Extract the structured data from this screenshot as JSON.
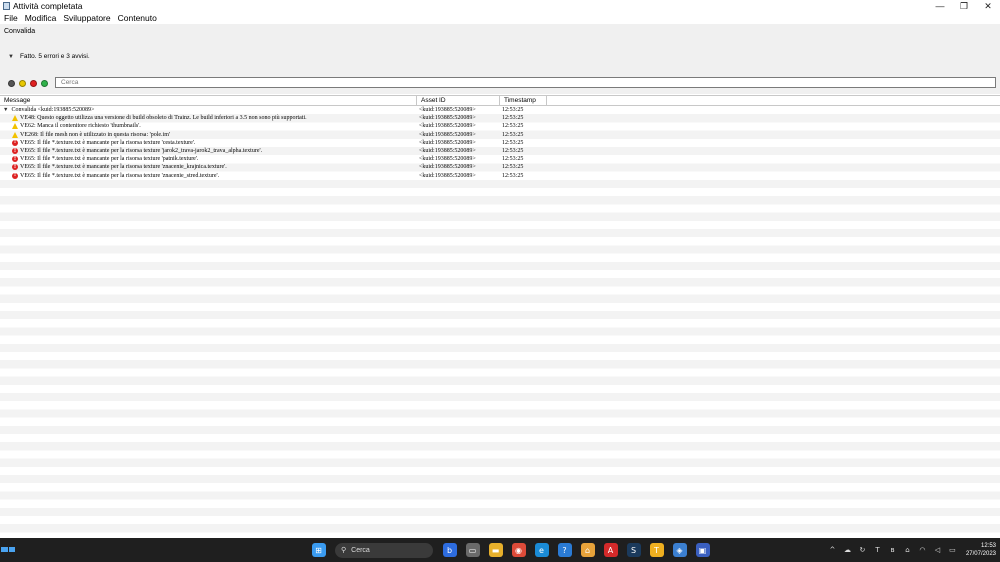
{
  "window": {
    "title": "Attività completata",
    "controls": {
      "minimize": "—",
      "maximize": "❐",
      "close": "✕"
    }
  },
  "menu": [
    "File",
    "Modifica",
    "Sviluppatore",
    "Contenuto"
  ],
  "section_title": "Convalida",
  "status_text": "Fatto. 5 errori e 3 avvisi.",
  "filters": {
    "dots": [
      "#555555",
      "#e8c800",
      "#e02020",
      "#2fb24a"
    ],
    "search_placeholder": "Cerca"
  },
  "table": {
    "columns": [
      "Message",
      "Asset ID",
      "Timestamp"
    ],
    "rows": [
      {
        "type": "group",
        "message": "Convalida <kuid:193885:520089>",
        "asset": "<kuid:193885:520089>",
        "time": "12:53:25"
      },
      {
        "type": "warn",
        "message": "VE48: Questo oggetto utilizza una versione di build obsoleto di Trainz. Le build inferiori a 3.5 non sono più supportati.",
        "asset": "<kuid:193885:520089>",
        "time": "12:53:25"
      },
      {
        "type": "warn",
        "message": "VE62: Manca il contenitore richiesto 'thumbnails'.",
        "asset": "<kuid:193885:520089>",
        "time": "12:53:25"
      },
      {
        "type": "warn",
        "message": "VE268: Il file mesh non è utilizzato in questa risorsa: 'pole.im'",
        "asset": "<kuid:193885:520089>",
        "time": "12:53:25"
      },
      {
        "type": "err",
        "message": "VE65: Il file *.texture.txt è mancante per la risorsa texture 'cesta.texture'.",
        "asset": "<kuid:193885:520089>",
        "time": "12:53:25"
      },
      {
        "type": "err",
        "message": "VE65: Il file *.texture.txt è mancante per la risorsa texture 'jarok2_trava-jarok2_trava_alpha.texture'.",
        "asset": "<kuid:193885:520089>",
        "time": "12:53:25"
      },
      {
        "type": "err",
        "message": "VE65: Il file *.texture.txt è mancante per la risorsa texture 'patnik.texture'.",
        "asset": "<kuid:193885:520089>",
        "time": "12:53:25"
      },
      {
        "type": "err",
        "message": "VE65: Il file *.texture.txt è mancante per la risorsa texture 'znacenie_krajnica.texture'.",
        "asset": "<kuid:193885:520089>",
        "time": "12:53:25"
      },
      {
        "type": "err",
        "message": "VE65: Il file *.texture.txt è mancante per la risorsa texture 'znacenie_stred.texture'.",
        "asset": "<kuid:193885:520089>",
        "time": "12:53:25"
      }
    ]
  },
  "taskbar": {
    "search_label": "Cerca",
    "apps": [
      {
        "name": "windows-start-icon",
        "color": "#3a9bf0",
        "glyph": "⊞"
      },
      {
        "name": "copilot-icon",
        "color": "#2d6cdf",
        "glyph": "b"
      },
      {
        "name": "task-view-icon",
        "color": "#6a6a6a",
        "glyph": "▭"
      },
      {
        "name": "file-explorer-icon",
        "color": "#e7b02b",
        "glyph": "▬"
      },
      {
        "name": "chrome-icon",
        "color": "#dd4b39",
        "glyph": "◉"
      },
      {
        "name": "edge-icon",
        "color": "#1a8bd6",
        "glyph": "e"
      },
      {
        "name": "help-icon",
        "color": "#2a7bd5",
        "glyph": "?"
      },
      {
        "name": "home-icon",
        "color": "#e8a33a",
        "glyph": "⌂"
      },
      {
        "name": "acrobat-icon",
        "color": "#d42a2a",
        "glyph": "A"
      },
      {
        "name": "steam-icon",
        "color": "#1b3a5c",
        "glyph": "S"
      },
      {
        "name": "trainz-icon",
        "color": "#f0b020",
        "glyph": "T"
      },
      {
        "name": "security-icon",
        "color": "#3b7fd0",
        "glyph": "◈"
      },
      {
        "name": "network-app-icon",
        "color": "#3a5fc0",
        "glyph": "▣"
      }
    ],
    "tray": [
      {
        "name": "chevron-up-icon",
        "glyph": "^"
      },
      {
        "name": "onedrive-icon",
        "glyph": "☁"
      },
      {
        "name": "sync-icon",
        "glyph": "↻"
      },
      {
        "name": "teams-icon",
        "glyph": "T"
      },
      {
        "name": "bluetooth-icon",
        "glyph": "ʙ"
      },
      {
        "name": "usb-icon",
        "glyph": "⌂"
      },
      {
        "name": "wifi-icon",
        "glyph": "◠"
      },
      {
        "name": "volume-icon",
        "glyph": "◁"
      },
      {
        "name": "battery-icon",
        "glyph": "▭"
      }
    ],
    "clock_time": "12:53",
    "clock_date": "27/07/2023"
  }
}
